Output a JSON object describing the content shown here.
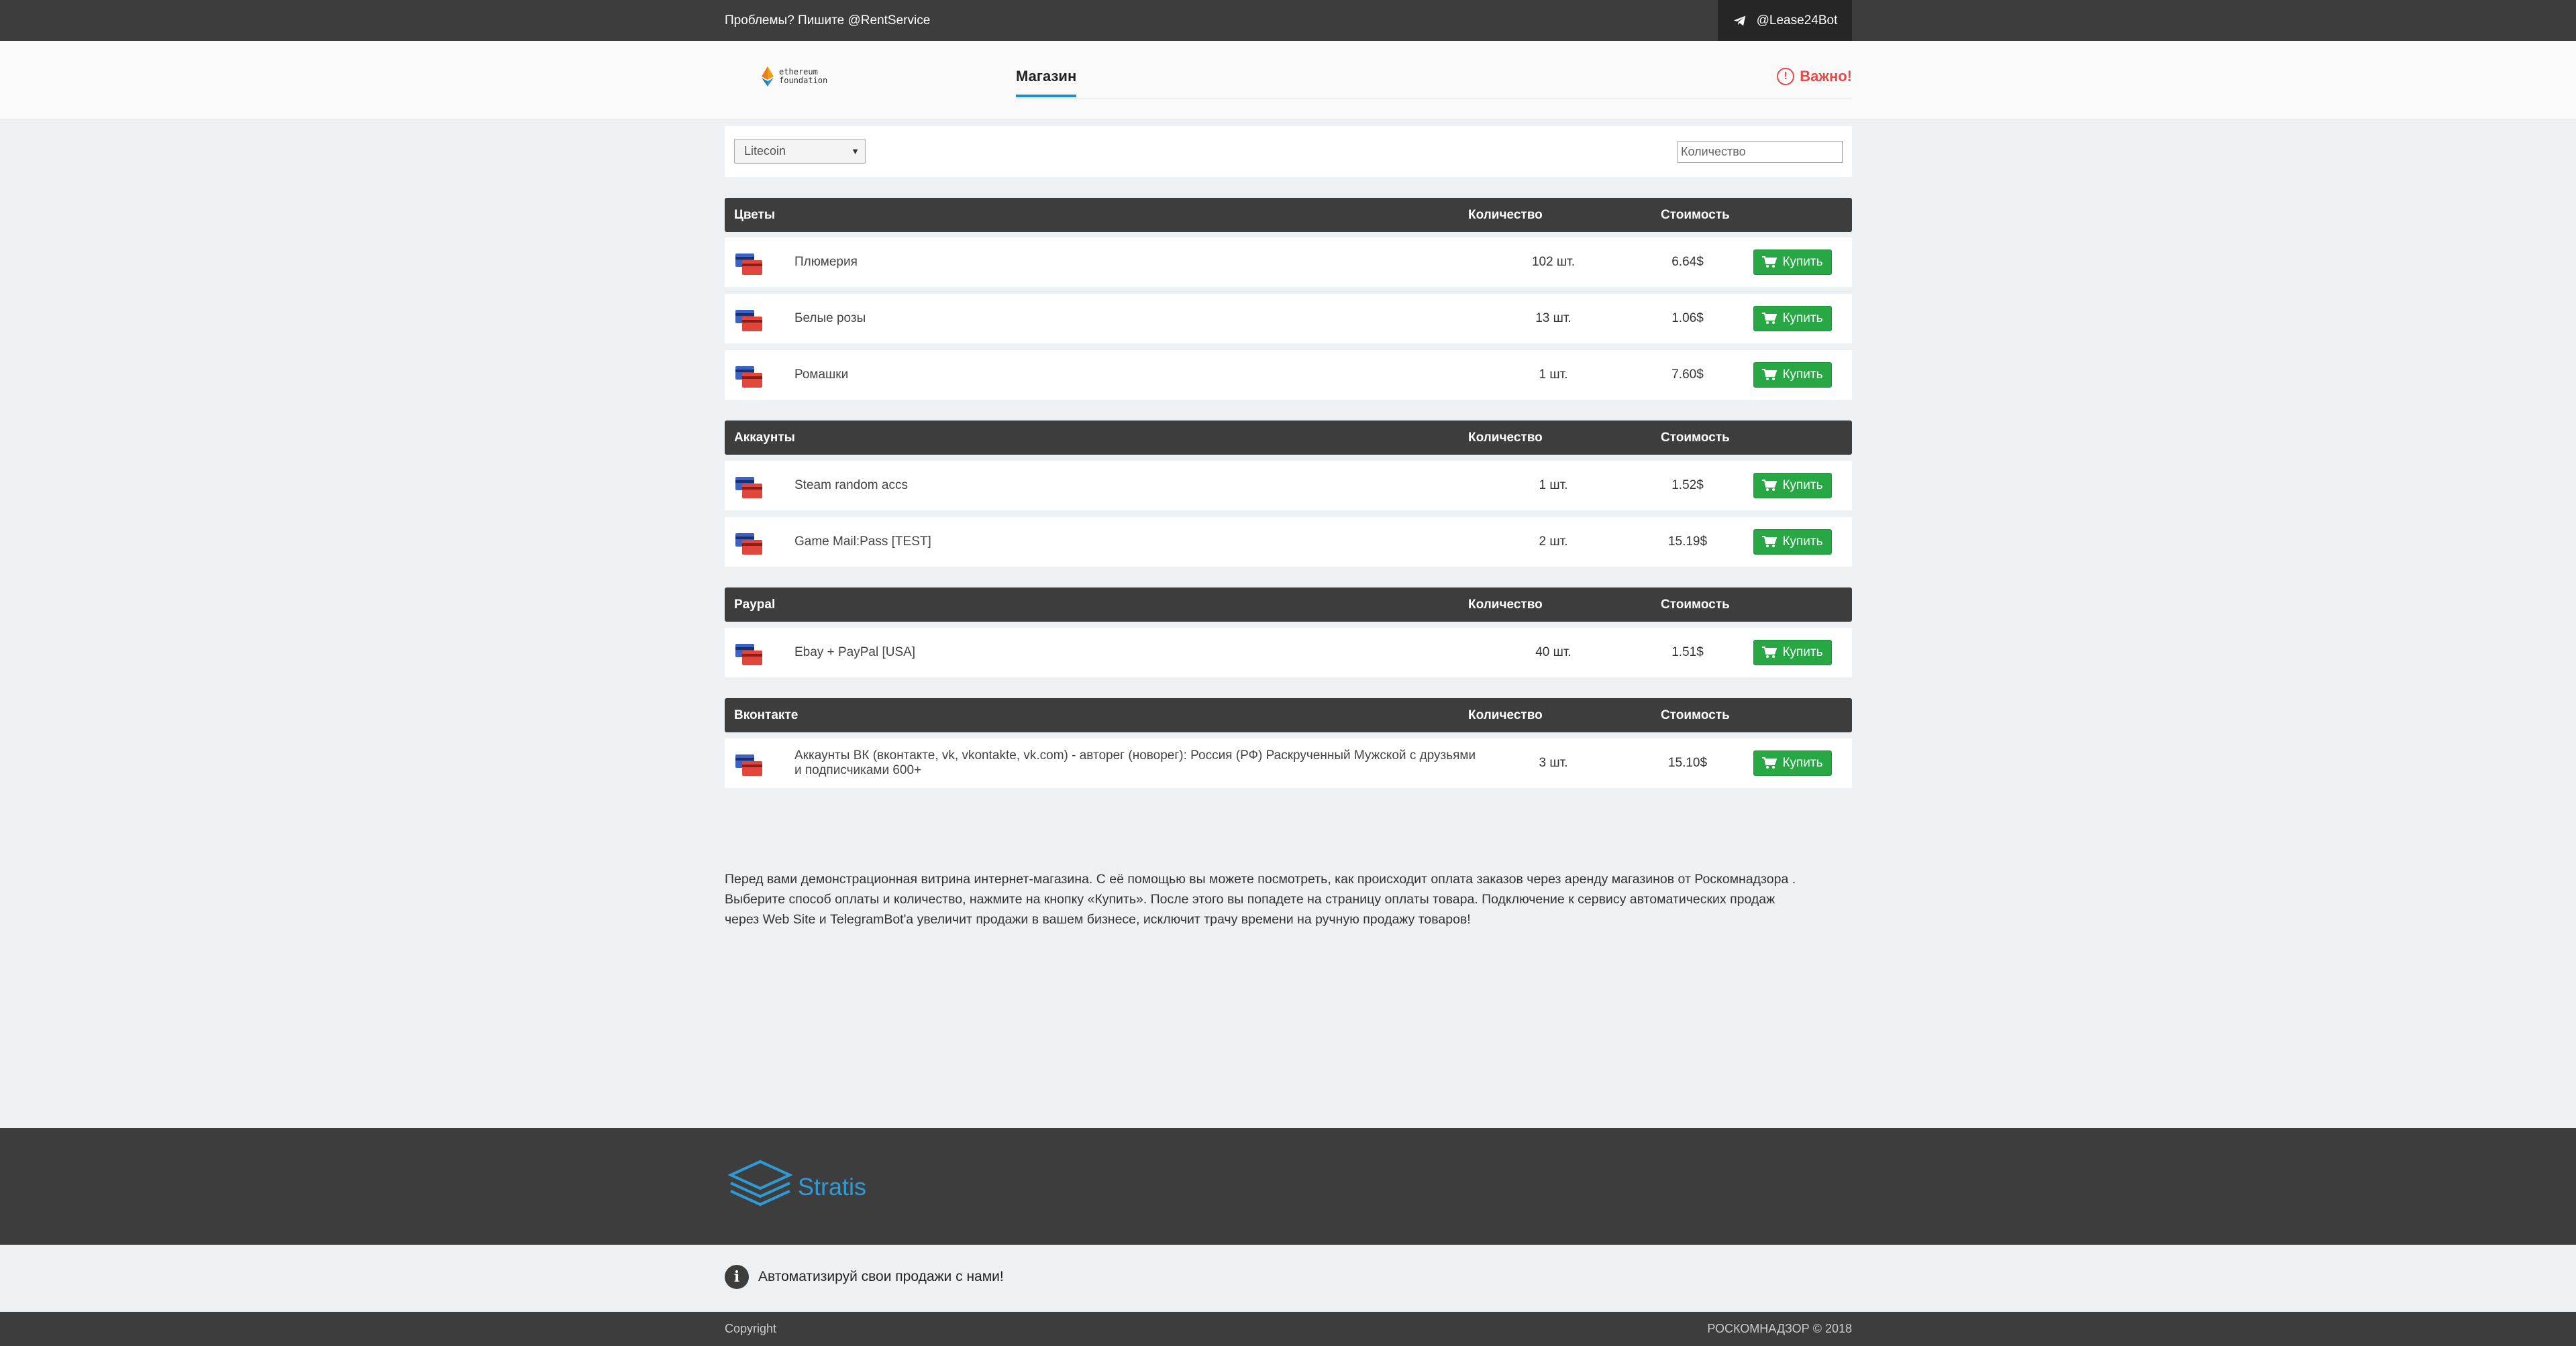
{
  "topbar": {
    "support_text": "Проблемы? Пишите @RentService",
    "bot_label": "@Lease24Bot"
  },
  "header": {
    "logo_line1": "ethereum",
    "logo_line2": "foundation",
    "tab_shop": "Магазин",
    "important_label": "Важно!"
  },
  "filter": {
    "currency_selected": "Litecoin",
    "quantity_placeholder": "Количество"
  },
  "columns": {
    "quantity": "Количество",
    "price": "Стоимость"
  },
  "buy_label": "Купить",
  "categories": [
    {
      "title": "Цветы",
      "items": [
        {
          "name": "Плюмерия",
          "qty": "102 шт.",
          "price": "6.64$"
        },
        {
          "name": "Белые розы",
          "qty": "13 шт.",
          "price": "1.06$"
        },
        {
          "name": "Ромашки",
          "qty": "1 шт.",
          "price": "7.60$"
        }
      ]
    },
    {
      "title": "Аккаунты",
      "items": [
        {
          "name": "Steam random accs",
          "qty": "1 шт.",
          "price": "1.52$"
        },
        {
          "name": "Game Mail:Pass [TEST]",
          "qty": "2 шт.",
          "price": "15.19$"
        }
      ]
    },
    {
      "title": "Paypal",
      "items": [
        {
          "name": "Ebay + PayPal [USA]",
          "qty": "40 шт.",
          "price": "1.51$"
        }
      ]
    },
    {
      "title": "Вконтакте",
      "items": [
        {
          "name": "Аккаунты ВК (вконтакте, vk, vkontakte, vk.com) - авторег (новорег): Россия (РФ) Раскрученный Мужской с друзьями и подписчиками 600+",
          "qty": "3 шт.",
          "price": "15.10$"
        }
      ]
    }
  ],
  "description": "Перед вами демонстрационная витрина интернет-магазина. С её помощью вы можете посмотреть, как происходит оплата заказов через аренду магазинов от Роскомнадзора . Выберите способ оплаты и количество, нажмите на кнопку «Купить». После этого вы попадете на страницу оплаты товара. Подключение к сервису автоматических продаж через Web Site и TelegramBot'a увеличит продажи в вашем бизнесе, исключит трачу времени на ручную продажу товаров!",
  "footer": {
    "brand": "Stratis",
    "info_text": "Автоматизируй свои продажи с нами!",
    "copyright": "Copyright",
    "right_text": "РОСКОМНАДЗОР © 2018"
  },
  "colors": {
    "dark_bar": "#3d3d3d",
    "buy_green": "#28a745",
    "accent_blue": "#1e8fcf",
    "important_red": "#e84a4a",
    "stratis_blue": "#2f9bd6"
  }
}
